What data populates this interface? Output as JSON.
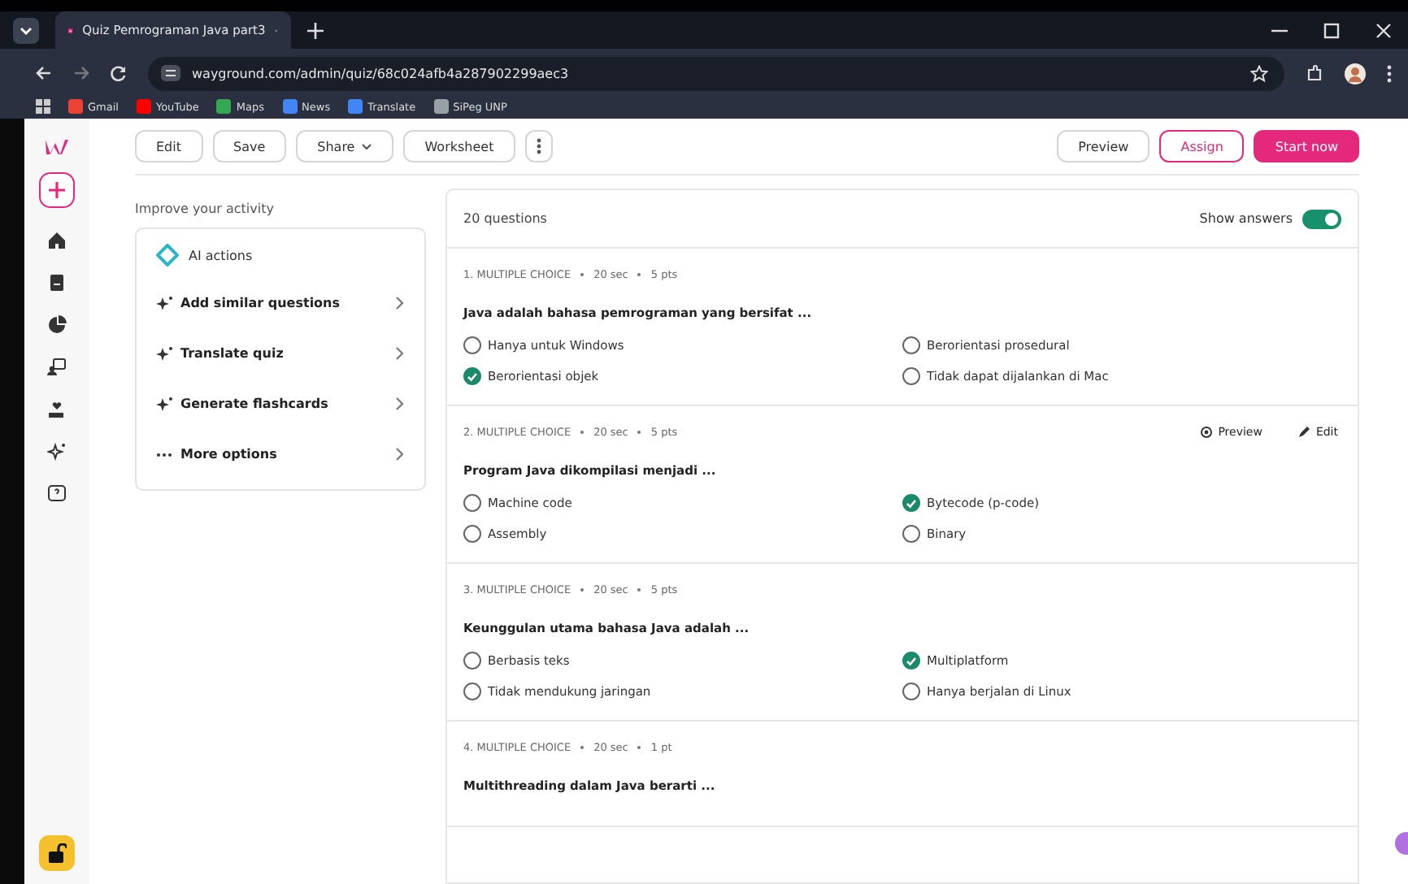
{
  "browser": {
    "tab_title": "Quiz Pemrograman Java part3",
    "url": "wayground.com/admin/quiz/68c024afb4a287902299aec3",
    "bookmarks": [
      {
        "label": "Gmail",
        "color": "#ea4335"
      },
      {
        "label": "YouTube",
        "color": "#ff0000"
      },
      {
        "label": "Maps",
        "color": "#34a853"
      },
      {
        "label": "News",
        "color": "#4285f4"
      },
      {
        "label": "Translate",
        "color": "#4285f4"
      },
      {
        "label": "SiPeg UNP",
        "color": "#9aa0a6"
      }
    ]
  },
  "toolbar": {
    "left": [
      {
        "label": "Edit",
        "kind": "outline"
      },
      {
        "label": "Save",
        "kind": "outline"
      },
      {
        "label": "Share",
        "kind": "dropdown"
      },
      {
        "label": "Worksheet",
        "kind": "outline"
      }
    ],
    "right": [
      {
        "label": "Preview",
        "kind": "outline"
      },
      {
        "label": "Assign",
        "kind": "assign"
      },
      {
        "label": "Start now",
        "kind": "primary"
      }
    ]
  },
  "improve": {
    "heading": "Improve your activity",
    "ai_header": "AI actions",
    "actions": [
      {
        "label": "Add similar questions",
        "kind": "sparkle"
      },
      {
        "label": "Translate quiz",
        "kind": "sparkle"
      },
      {
        "label": "Generate flashcards",
        "kind": "sparkle"
      },
      {
        "label": "More options",
        "kind": "more"
      }
    ]
  },
  "quiz": {
    "count": "20 questions",
    "show_answers": {
      "label": "Show answers",
      "on": true
    },
    "questions": [
      {
        "type": "1. MULTIPLE CHOICE",
        "time": "20 sec",
        "points": "5 pts",
        "text": "Java adalah bahasa pemrograman yang bersifat ...",
        "options": [
          {
            "text": "Hanya untuk Windows",
            "correct": false
          },
          {
            "text": "Berorientasi prosedural",
            "correct": false
          },
          {
            "text": "Berorientasi objek",
            "correct": true
          },
          {
            "text": "Tidak dapat dijalankan di Mac",
            "correct": false
          }
        ]
      },
      {
        "type": "2. MULTIPLE CHOICE",
        "time": "20 sec",
        "points": "5 pts",
        "text": "Program Java dikompilasi menjadi ...",
        "preview": "Preview",
        "edit": "Edit",
        "options": [
          {
            "text": "Machine code",
            "correct": false
          },
          {
            "text": "Bytecode (p-code)",
            "correct": true
          },
          {
            "text": "Assembly",
            "correct": false
          },
          {
            "text": "Binary",
            "correct": false
          }
        ]
      },
      {
        "type": "3. MULTIPLE CHOICE",
        "time": "20 sec",
        "points": "5 pts",
        "text": "Keunggulan utama bahasa Java adalah ...",
        "options": [
          {
            "text": "Berbasis teks",
            "correct": false
          },
          {
            "text": "Multiplatform",
            "correct": true
          },
          {
            "text": "Tidak mendukung jaringan",
            "correct": false
          },
          {
            "text": "Hanya berjalan di Linux",
            "correct": false
          }
        ]
      },
      {
        "type": "4. MULTIPLE CHOICE",
        "time": "20 sec",
        "points": "1 pt",
        "text": "Multithreading dalam Java berarti ..."
      }
    ]
  }
}
